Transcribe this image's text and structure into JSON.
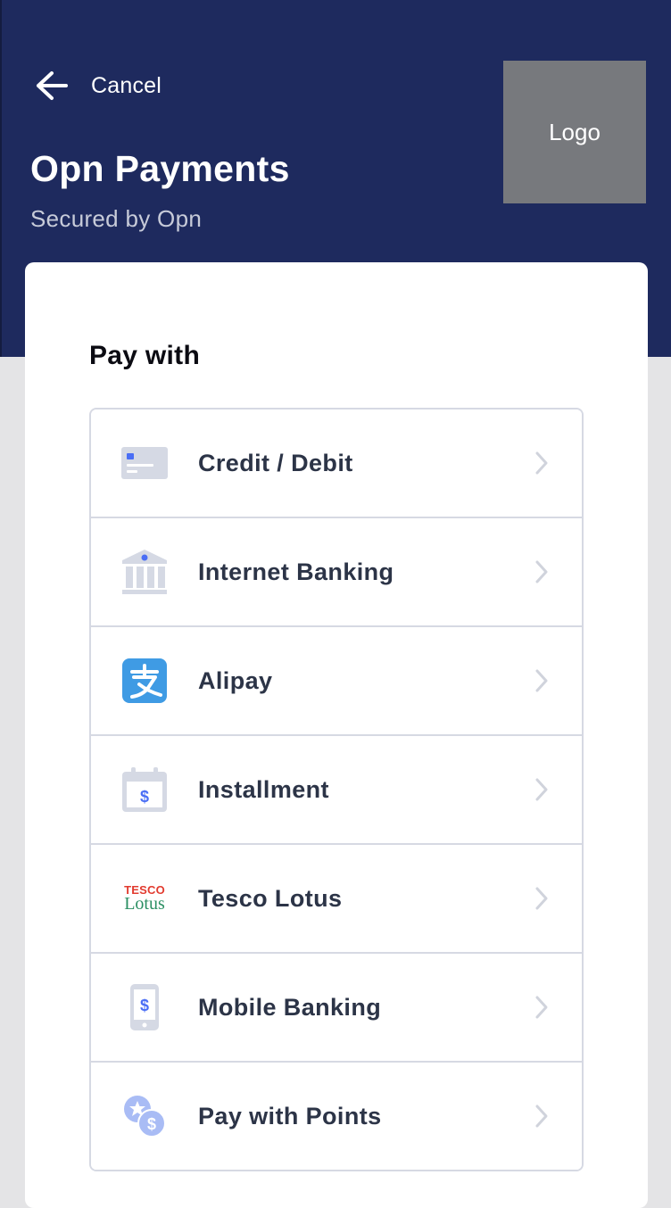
{
  "header": {
    "cancel_label": "Cancel",
    "merchant_name": "Opn Payments",
    "secured_by": "Secured by Opn",
    "logo_placeholder": "Logo",
    "background_color": "#1e2a5e"
  },
  "main": {
    "heading": "Pay with",
    "methods": [
      {
        "label": "Credit / Debit",
        "icon": "credit-card-icon"
      },
      {
        "label": "Internet Banking",
        "icon": "bank-icon"
      },
      {
        "label": "Alipay",
        "icon": "alipay-icon"
      },
      {
        "label": "Installment",
        "icon": "installment-calendar-icon"
      },
      {
        "label": "Tesco Lotus",
        "icon": "tesco-lotus-logo",
        "logo_text": [
          "TESCO",
          "Lotus"
        ]
      },
      {
        "label": "Mobile Banking",
        "icon": "mobile-banking-icon"
      },
      {
        "label": "Pay with Points",
        "icon": "points-coins-icon"
      }
    ]
  },
  "colors": {
    "accent": "#4a6ef5",
    "icon_gray": "#d5d9e4",
    "alipay_blue": "#3f9be4",
    "text_dark": "#2c3447"
  }
}
